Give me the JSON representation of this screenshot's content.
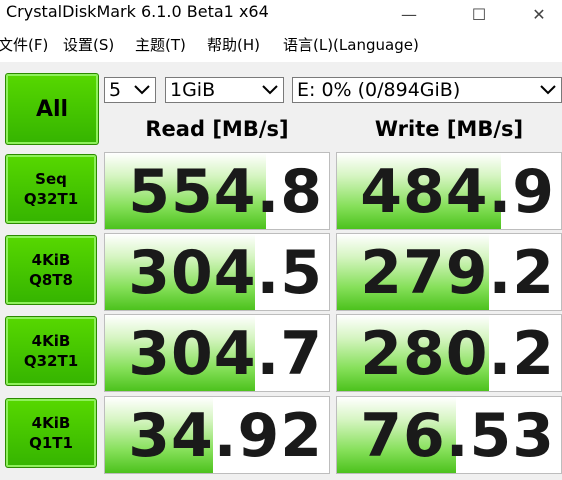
{
  "window": {
    "title": "CrystalDiskMark 6.1.0 Beta1 x64",
    "minimize": "—",
    "maximize": "☐",
    "close": "✕"
  },
  "menu": {
    "items": [
      "文件(F)",
      "设置(S)",
      "主题(T)",
      "帮助(H)",
      "语言(L)(Language)"
    ]
  },
  "controls": {
    "all_label": "All",
    "count": "5",
    "size": "1GiB",
    "drive": "E: 0% (0/894GiB)"
  },
  "headers": {
    "read": "Read [MB/s]",
    "write": "Write [MB/s]"
  },
  "rows": [
    {
      "line1": "Seq",
      "line2": "Q32T1",
      "read": "554.8",
      "write": "484.9",
      "read_fill": 0.72,
      "write_fill": 0.73
    },
    {
      "line1": "4KiB",
      "line2": "Q8T8",
      "read": "304.5",
      "write": "279.2",
      "read_fill": 0.67,
      "write_fill": 0.68
    },
    {
      "line1": "4KiB",
      "line2": "Q32T1",
      "read": "304.7",
      "write": "280.2",
      "read_fill": 0.67,
      "write_fill": 0.68
    },
    {
      "line1": "4KiB",
      "line2": "Q1T1",
      "read": "34.92",
      "write": "76.53",
      "read_fill": 0.48,
      "write_fill": 0.53
    }
  ]
}
